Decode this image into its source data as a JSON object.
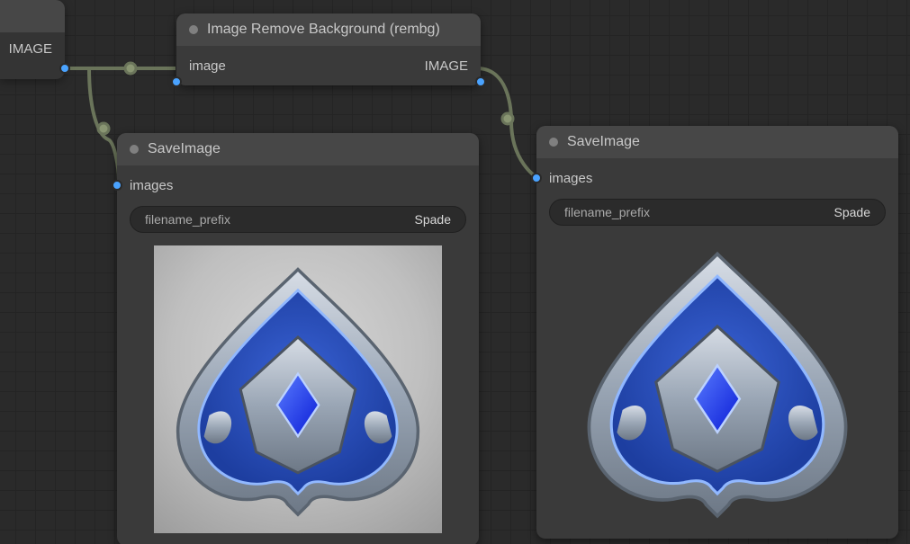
{
  "source_node": {
    "output_label": "IMAGE"
  },
  "rembg_node": {
    "title": "Image Remove Background (rembg)",
    "input_label": "image",
    "output_label": "IMAGE"
  },
  "save_node_left": {
    "title": "SaveImage",
    "input_label": "images",
    "field_label": "filename_prefix",
    "field_value": "Spade"
  },
  "save_node_right": {
    "title": "SaveImage",
    "input_label": "images",
    "field_label": "filename_prefix",
    "field_value": "Spade"
  }
}
